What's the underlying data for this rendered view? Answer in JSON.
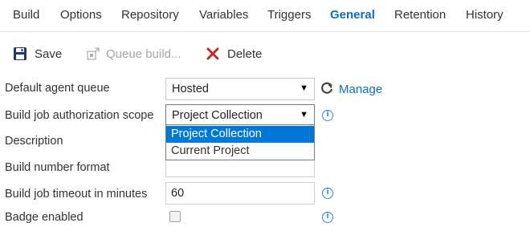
{
  "tabs": [
    {
      "label": "Build"
    },
    {
      "label": "Options"
    },
    {
      "label": "Repository"
    },
    {
      "label": "Variables"
    },
    {
      "label": "Triggers"
    },
    {
      "label": "General",
      "active": true
    },
    {
      "label": "Retention"
    },
    {
      "label": "History"
    }
  ],
  "toolbar": {
    "save_label": "Save",
    "queue_label": "Queue build...",
    "delete_label": "Delete"
  },
  "form": {
    "agent_queue": {
      "label": "Default agent queue",
      "value": "Hosted",
      "manage_label": "Manage"
    },
    "auth_scope": {
      "label": "Build job authorization scope",
      "value": "Project Collection",
      "options": [
        "Project Collection",
        "Current Project"
      ]
    },
    "description": {
      "label": "Description",
      "value": ""
    },
    "number_format": {
      "label": "Build number format",
      "value": ""
    },
    "timeout": {
      "label": "Build job timeout in minutes",
      "value": "60"
    },
    "badge": {
      "label": "Badge enabled",
      "checked": false
    }
  },
  "colors": {
    "accent": "#106ebe",
    "selection": "#0078d7",
    "info": "#2b88d8",
    "delete_red": "#c62828",
    "save_blue": "#1e3a6e"
  },
  "icons": {
    "save": "floppy-disk-icon",
    "queue": "queue-build-icon",
    "delete": "x-icon",
    "refresh": "refresh-icon",
    "info": "info-icon"
  }
}
